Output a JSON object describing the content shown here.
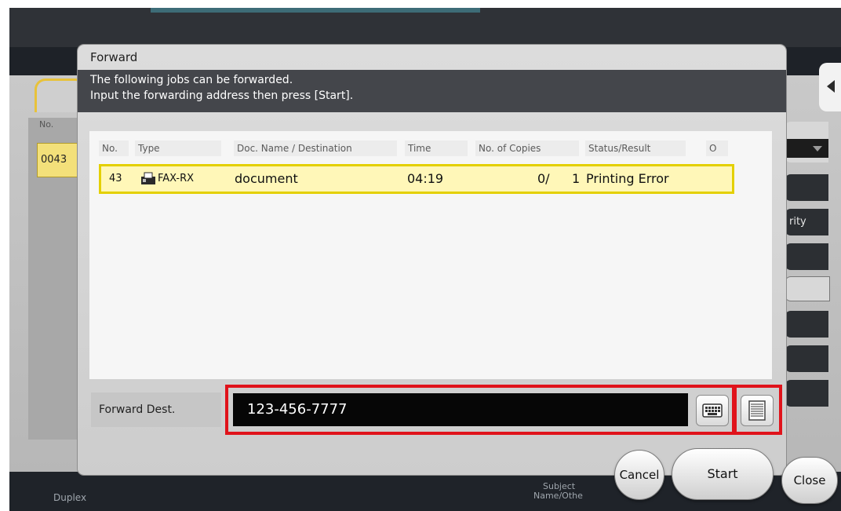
{
  "dialog": {
    "title": "Forward",
    "message_line1": "The following jobs can be forwarded.",
    "message_line2": "Input the forwarding address then press [Start]."
  },
  "columns": [
    "No.",
    "Type",
    "Doc. Name / Destination",
    "Time",
    "No. of Copies",
    "Status/Result",
    "O"
  ],
  "jobs": [
    {
      "no": "43",
      "type": "FAX-RX",
      "name": "document",
      "time": "04:19",
      "copies": "0/",
      "copies_total": "1",
      "status": "Printing Error"
    }
  ],
  "forward": {
    "label": "Forward Dest.",
    "value": "123-456-7777",
    "keyboard_icon": "keyboard-icon",
    "addressbook_icon": "address-book-icon"
  },
  "buttons": {
    "cancel": "Cancel",
    "start": "Start",
    "close": "Close"
  },
  "background": {
    "col_no": "No.",
    "job_no": "0043",
    "side_label": "rity",
    "footer_duplex": "Duplex",
    "footer_subject": "Subject",
    "footer_name": "Name/Othe"
  },
  "colors": {
    "highlight_border": "#e0131b",
    "selected_row": "#fff7b8",
    "selected_row_border": "#e4d000"
  }
}
